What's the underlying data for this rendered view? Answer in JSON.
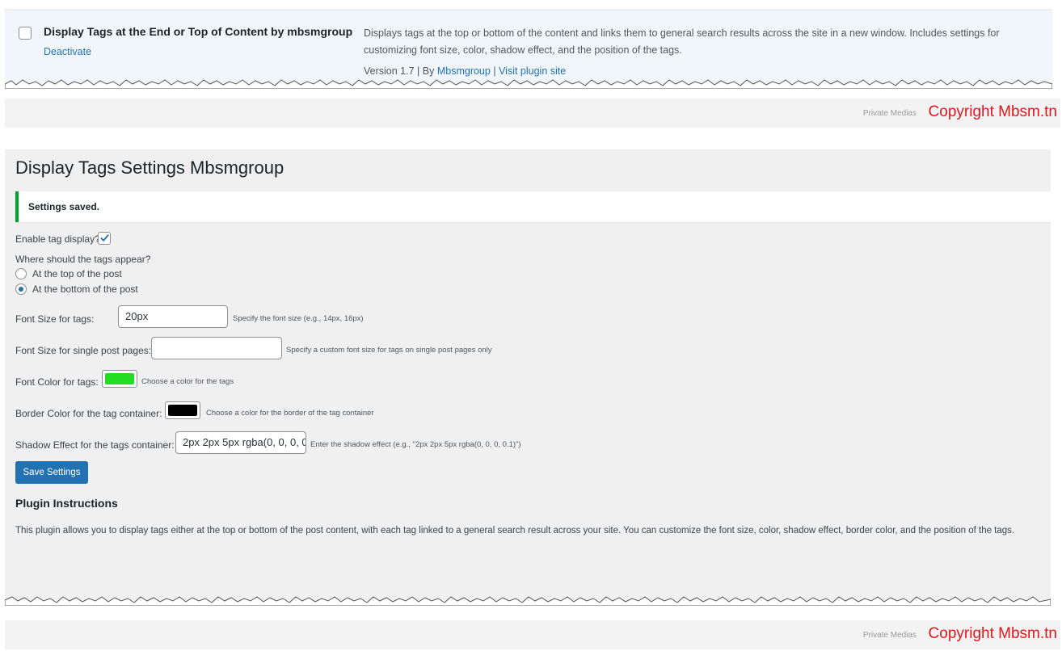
{
  "plugin_row": {
    "name": "Display Tags at the End or Top of Content by mbsmgroup",
    "action": "Deactivate",
    "description": "Displays tags at the top or bottom of the content and links them to general search results across the site in a new window. Includes settings for customizing font size, color, shadow effect, and the position of the tags.",
    "version": "Version 1.7",
    "by": "By",
    "author": "Mbsmgroup",
    "separator": "|",
    "visit": "Visit plugin site"
  },
  "watermark": {
    "private": "Private Medias",
    "copyright": "Copyright Mbsm.tn"
  },
  "settings": {
    "title": "Display Tags Settings Mbsmgroup",
    "notice": "Settings saved.",
    "enable_label": "Enable tag display?",
    "enable_checked": true,
    "position_question": "Where should the tags appear?",
    "position_options": [
      {
        "label": "At the top of the post",
        "selected": false
      },
      {
        "label": "At the bottom of the post",
        "selected": true
      }
    ],
    "font_size": {
      "label": "Font Size for tags:",
      "value": "20px",
      "hint": "Specify the font size (e.g., 14px, 16px)"
    },
    "single_font_size": {
      "label": "Font Size for single post pages:",
      "value": "",
      "hint": "Specify a custom font size for tags on single post pages only"
    },
    "font_color": {
      "label": "Font Color for tags:",
      "color": "#22dd22",
      "hint": "Choose a color for the tags"
    },
    "border_color": {
      "label": "Border Color for the tag container:",
      "color": "#000000",
      "hint": "Choose a color for the border of the tag container"
    },
    "shadow": {
      "label": "Shadow Effect for the tags container:",
      "value": "2px 2px 5px rgba(0, 0, 0, 0",
      "hint": "Enter the shadow effect (e.g., \"2px 2px 5px rgba(0, 0, 0, 0.1)\")"
    },
    "save_label": "Save Settings",
    "instructions_title": "Plugin Instructions",
    "instructions_text": "This plugin allows you to display tags either at the top or bottom of the post content, with each tag linked to a general search result across your site. You can customize the font size, color, shadow effect, border color, and the position of the tags."
  },
  "colors": {
    "accent": "#2271b1",
    "success": "#00a32a",
    "copyright": "#e0161c"
  }
}
